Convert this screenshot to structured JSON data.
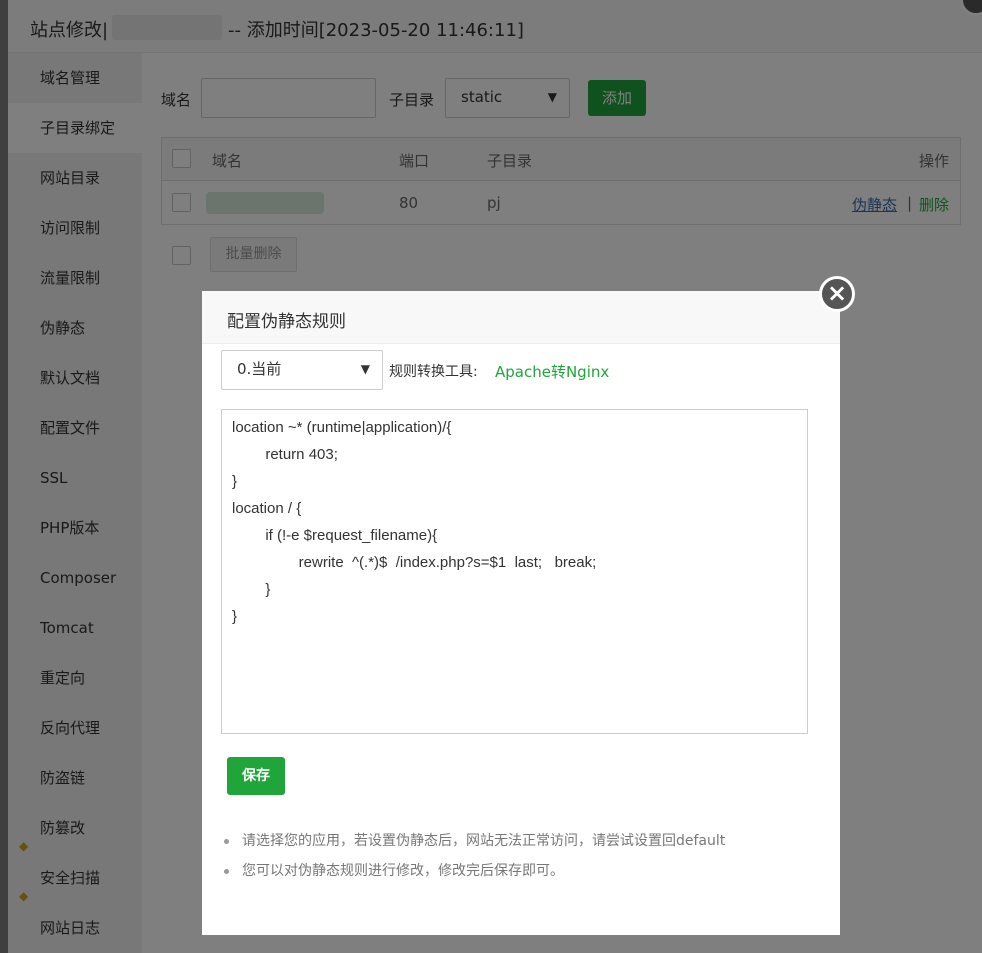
{
  "window": {
    "title_prefix": "站点修改|",
    "title_suffix": "-- 添加时间[2023-05-20 11:46:11]"
  },
  "sidebar": {
    "items": [
      {
        "label": "域名管理"
      },
      {
        "label": "子目录绑定",
        "active": true
      },
      {
        "label": "网站目录"
      },
      {
        "label": "访问限制"
      },
      {
        "label": "流量限制"
      },
      {
        "label": "伪静态"
      },
      {
        "label": "默认文档"
      },
      {
        "label": "配置文件"
      },
      {
        "label": "SSL"
      },
      {
        "label": "PHP版本"
      },
      {
        "label": "Composer"
      },
      {
        "label": "Tomcat"
      },
      {
        "label": "重定向"
      },
      {
        "label": "反向代理"
      },
      {
        "label": "防盗链"
      },
      {
        "label": "防篡改",
        "icon": "gem-icon"
      },
      {
        "label": "安全扫描",
        "icon": "gem-icon"
      },
      {
        "label": "网站日志"
      }
    ]
  },
  "form": {
    "domain_label": "域名",
    "domain_value": "",
    "subdir_label": "子目录",
    "subdir_selected": "static",
    "add_label": "添加"
  },
  "table": {
    "headers": {
      "domain": "域名",
      "port": "端口",
      "subdir": "子目录",
      "ops": "操作"
    },
    "rows": [
      {
        "port": "80",
        "subdir": "pj",
        "op_rewrite": "伪静态",
        "sep": "|",
        "op_delete": "删除"
      }
    ],
    "batch_delete_label": "批量删除"
  },
  "dialog": {
    "title": "配置伪静态规则",
    "template_selected": "0.当前",
    "tool_label": "规则转换工具:",
    "tool_link": "Apache转Nginx",
    "rules": "location ~* (runtime|application)/{\n        return 403;\n}\nlocation / {\n        if (!-e $request_filename){\n                rewrite  ^(.*)$  /index.php?s=$1  last;   break;\n        }\n}",
    "save_label": "保存",
    "tips": [
      "请选择您的应用，若设置伪静态后，网站无法正常访问，请尝试设置回default",
      "您可以对伪静态规则进行修改，修改完后保存即可。"
    ]
  },
  "colors": {
    "accent": "#20a53a",
    "link": "#3a6ba5"
  }
}
